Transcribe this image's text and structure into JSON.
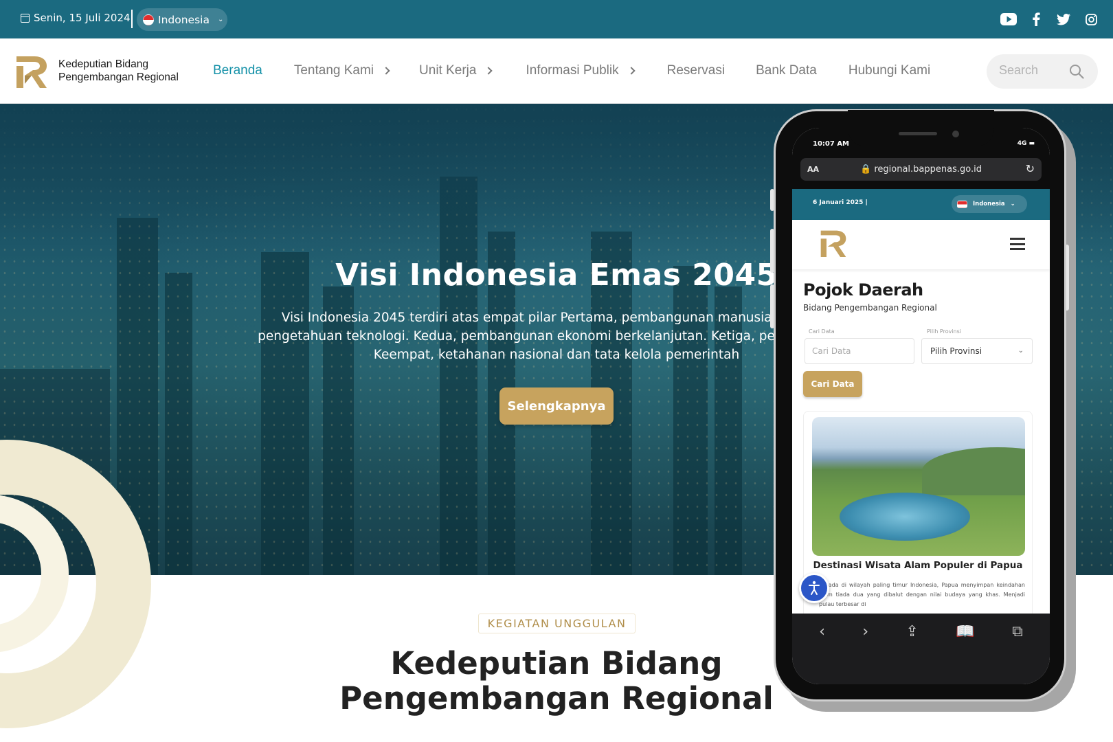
{
  "topbar": {
    "date": "Senin, 15 Juli 2024",
    "language": "Indonesia",
    "social_icons": [
      "youtube-icon",
      "facebook-icon",
      "twitter-icon",
      "instagram-icon"
    ]
  },
  "nav": {
    "brand_line1": "Kedeputian Bidang",
    "brand_line2": "Pengembangan Regional",
    "items": [
      {
        "label": "Beranda",
        "active": true,
        "has_submenu": false
      },
      {
        "label": "Tentang Kami",
        "active": false,
        "has_submenu": true
      },
      {
        "label": "Unit Kerja",
        "active": false,
        "has_submenu": true
      },
      {
        "label": "Informasi Publik",
        "active": false,
        "has_submenu": true
      },
      {
        "label": "Reservasi",
        "active": false,
        "has_submenu": false
      },
      {
        "label": "Bank Data",
        "active": false,
        "has_submenu": false
      },
      {
        "label": "Hubungi Kami",
        "active": false,
        "has_submenu": false
      }
    ],
    "search_placeholder": "Search"
  },
  "hero": {
    "title": "Visi Indonesia Emas 2045",
    "lead": "Visi Indonesia 2045 terdiri atas empat pilar Pertama, pembangunan manusia dan ilmu pengetahuan teknologi. Kedua, pembangunan ekonomi berkelanjutan. Ketiga, pembangunan. Keempat, ketahanan nasional dan tata kelola pemerintah",
    "button": "Selengkapnya"
  },
  "section": {
    "tag": "KEGIATAN UNGGULAN",
    "heading": "Kedeputian Bidang Pengembangan Regional"
  },
  "phone": {
    "status_time": "10:07 AM",
    "status_right": "4G",
    "aa": "AA",
    "url": "regional.bappenas.go.id",
    "top_date": "6 Januari 2025 |",
    "top_lang": "Indonesia",
    "title": "Pojok Daerah",
    "subtitle": "Bidang Pengembangan Regional",
    "search_label": "Cari Data",
    "search_placeholder": "Cari Data",
    "province_label": "Pilih Provinsi",
    "province_value": "Pilih Provinsi",
    "search_button": "Cari Data",
    "card_title": "Destinasi Wisata Alam Populer di Papua",
    "card_text": "Berada di wilayah paling timur Indonesia, Papua menyimpan keindahan alam tiada dua yang dibalut dengan nilai budaya yang khas. Menjadi pulau terbesar di",
    "toolbar_icons": [
      "back-icon",
      "forward-icon",
      "share-icon",
      "bookmarks-icon",
      "tabs-icon"
    ]
  },
  "colors": {
    "topbar": "#1b6a80",
    "gold": "#c7a35e",
    "active_nav": "#1591a8"
  }
}
